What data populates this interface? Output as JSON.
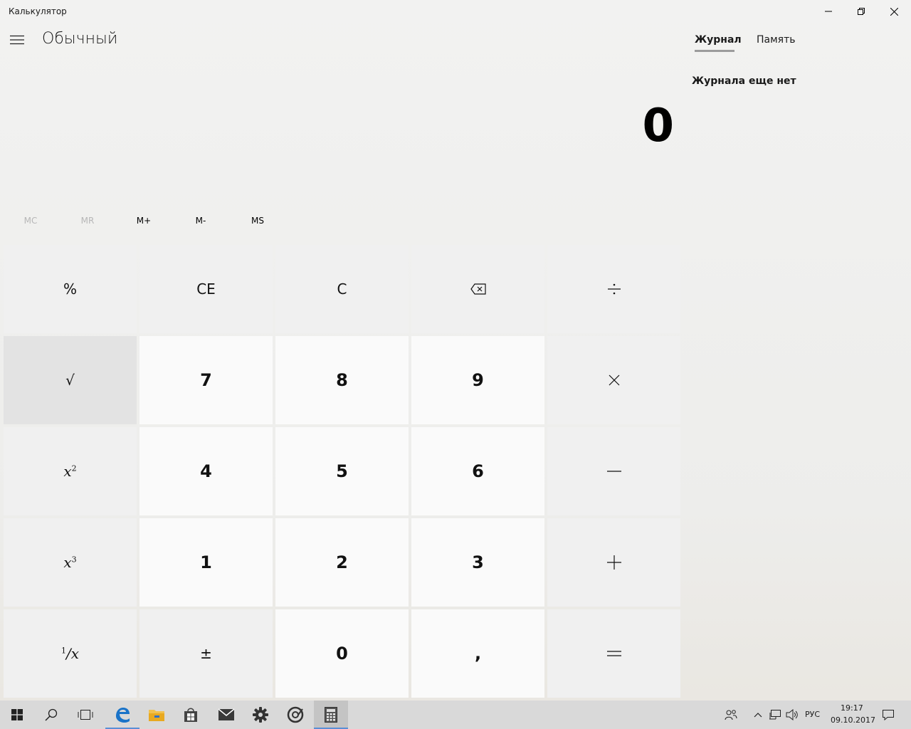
{
  "window": {
    "title": "Калькулятор"
  },
  "header": {
    "mode": "Обычный"
  },
  "display": {
    "value": "0"
  },
  "memory": {
    "mc": "MC",
    "mr": "MR",
    "mplus": "M+",
    "mminus": "M-",
    "ms": "MS"
  },
  "keys": {
    "percent": "%",
    "ce": "CE",
    "c": "C",
    "sqrt": "√",
    "n7": "7",
    "n8": "8",
    "n9": "9",
    "n4": "4",
    "n5": "5",
    "n6": "6",
    "n1": "1",
    "n2": "2",
    "n3": "3",
    "n0": "0",
    "plusminus": "±",
    "decimal": ","
  },
  "side_panel": {
    "tab_history": "Журнал",
    "tab_memory": "Память",
    "history_empty": "Журнала еще нет"
  },
  "taskbar": {
    "language": "РУС",
    "time": "19:17",
    "date": "09.10.2017"
  },
  "icons": {
    "window": [
      "minimize-icon",
      "restore-icon",
      "close-icon"
    ],
    "header": [
      "hamburger-menu-icon"
    ],
    "keys": [
      "backspace-icon",
      "divide-icon",
      "multiply-icon",
      "minus-icon",
      "plus-icon",
      "equals-icon"
    ],
    "taskbar": [
      "windows-start-icon",
      "search-icon",
      "task-view-icon",
      "edge-icon",
      "file-explorer-icon",
      "store-icon",
      "mail-icon",
      "settings-icon",
      "groove-icon",
      "calculator-icon",
      "people-icon",
      "chevron-up-icon",
      "network-icon",
      "volume-icon",
      "action-center-icon"
    ]
  },
  "colors": {
    "numeric_key": "#fafafa",
    "function_key": "#f0f0f0",
    "hover_key": "#e3e3e3",
    "taskbar": "#d9d9d9",
    "taskbar_active_indicator": "#5a8fd6"
  }
}
